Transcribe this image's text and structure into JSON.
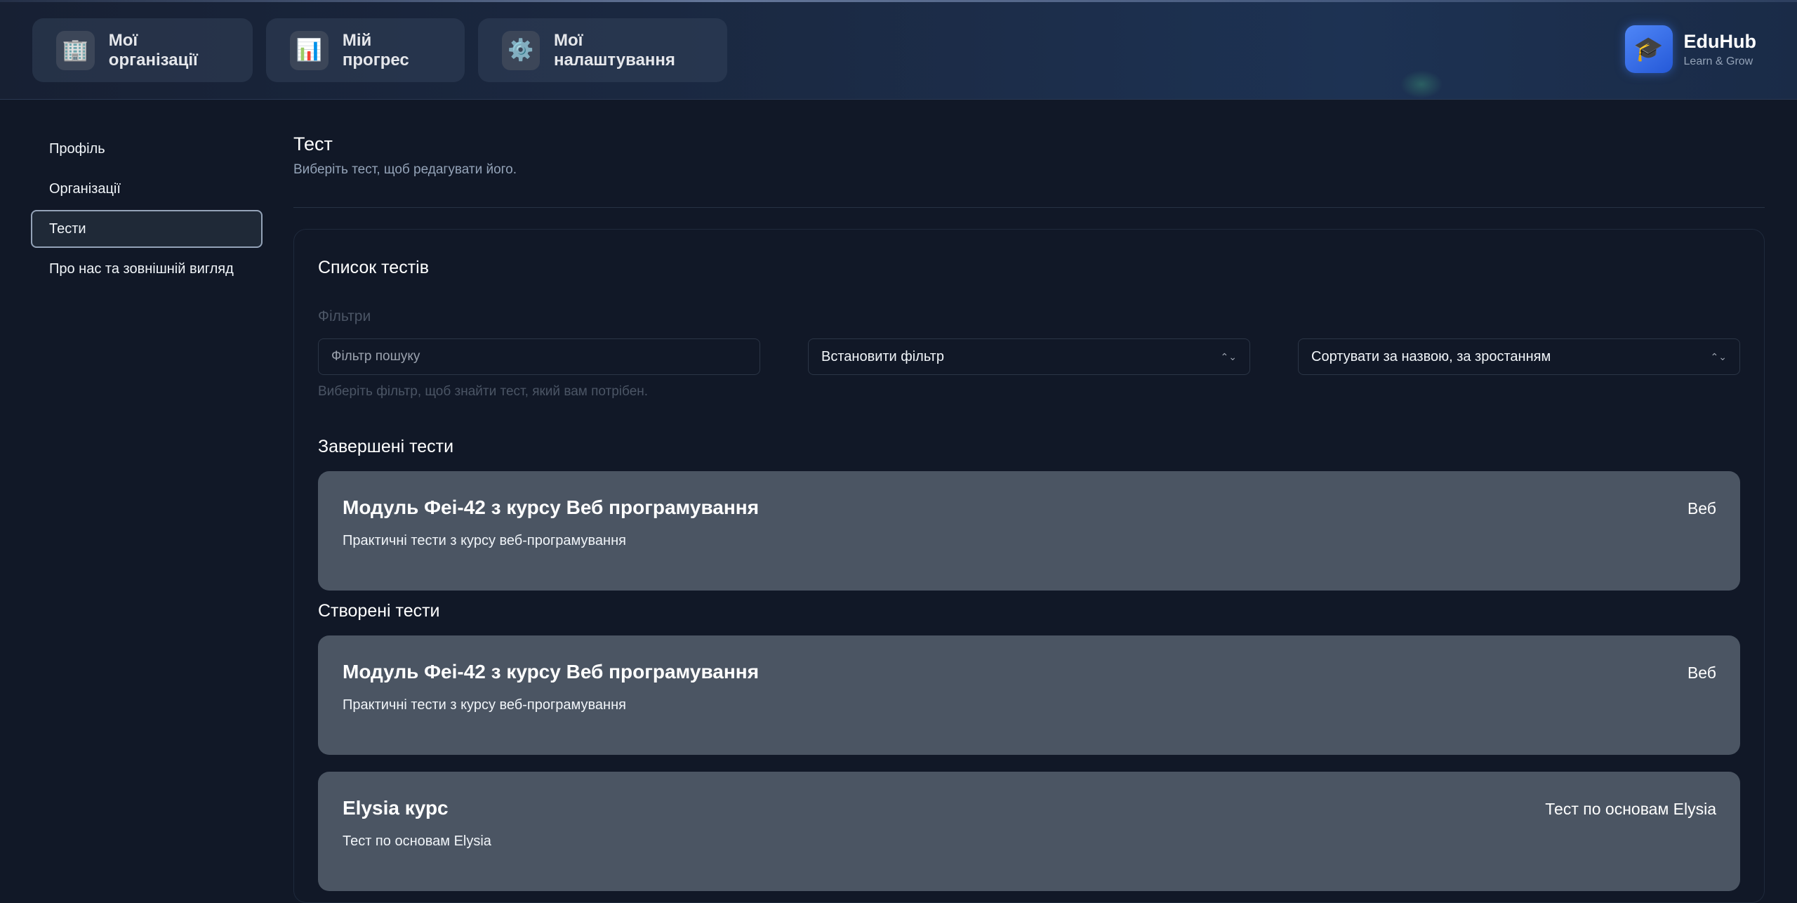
{
  "header": {
    "nav": [
      {
        "label": "Мої організації",
        "icon": "🏢"
      },
      {
        "label": "Мій прогрес",
        "icon": "📊"
      },
      {
        "label": "Мої налаштування",
        "icon": "⚙️"
      }
    ],
    "brand": {
      "name": "EduHub",
      "tagline": "Learn & Grow",
      "icon": "🎓"
    }
  },
  "sidebar": {
    "items": [
      {
        "label": "Профіль"
      },
      {
        "label": "Організації"
      },
      {
        "label": "Тести"
      },
      {
        "label": "Про нас та зовнішній вигляд"
      }
    ],
    "active_index": 2
  },
  "main": {
    "title": "Тест",
    "subtitle": "Виберіть тест, щоб редагувати його.",
    "card_title": "Список тестів",
    "filters": {
      "label": "Фільтри",
      "search_placeholder": "Фільтр пошуку",
      "filter_select": "Встановити фільтр",
      "sort_select": "Сортувати за назвою, за зростанням",
      "hint": "Виберіть фільтр, щоб знайти тест, який вам потрібен."
    },
    "completed": {
      "heading": "Завершені тести",
      "tests": [
        {
          "name": "Модуль Феі-42 з курсу Веб програмування",
          "description": "Практичні тести з курсу веб-програмування",
          "category": "Веб"
        }
      ]
    },
    "created": {
      "heading": "Створені тести",
      "tests": [
        {
          "name": "Модуль Феі-42 з курсу Веб програмування",
          "description": "Практичні тести з курсу веб-програмування",
          "category": "Веб"
        },
        {
          "name": "Elysia курс",
          "description": "Тест по основам Elysia",
          "category": "Тест по основам Elysia"
        }
      ]
    }
  },
  "colors": {
    "background": "#111827",
    "card": "#4b5563",
    "accent": "#3b82f6"
  }
}
